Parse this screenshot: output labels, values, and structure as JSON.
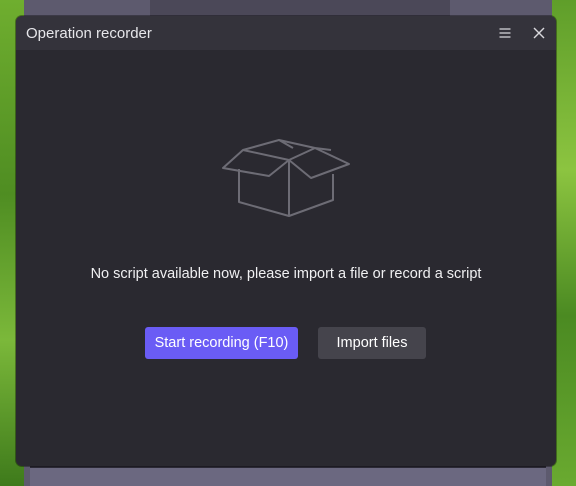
{
  "window": {
    "title": "Operation recorder",
    "menu_icon": "hamburger-menu-icon",
    "close_icon": "close-icon"
  },
  "empty_state": {
    "icon": "open-box-icon",
    "message": "No script available now, please import a file or record a script"
  },
  "actions": {
    "start_recording_label": "Start recording  (F10)",
    "import_files_label": "Import files"
  },
  "colors": {
    "primary_button": "#6a5cf5",
    "secondary_button": "#45444c",
    "window_background": "#2a2930",
    "titlebar_background": "#34333b"
  }
}
